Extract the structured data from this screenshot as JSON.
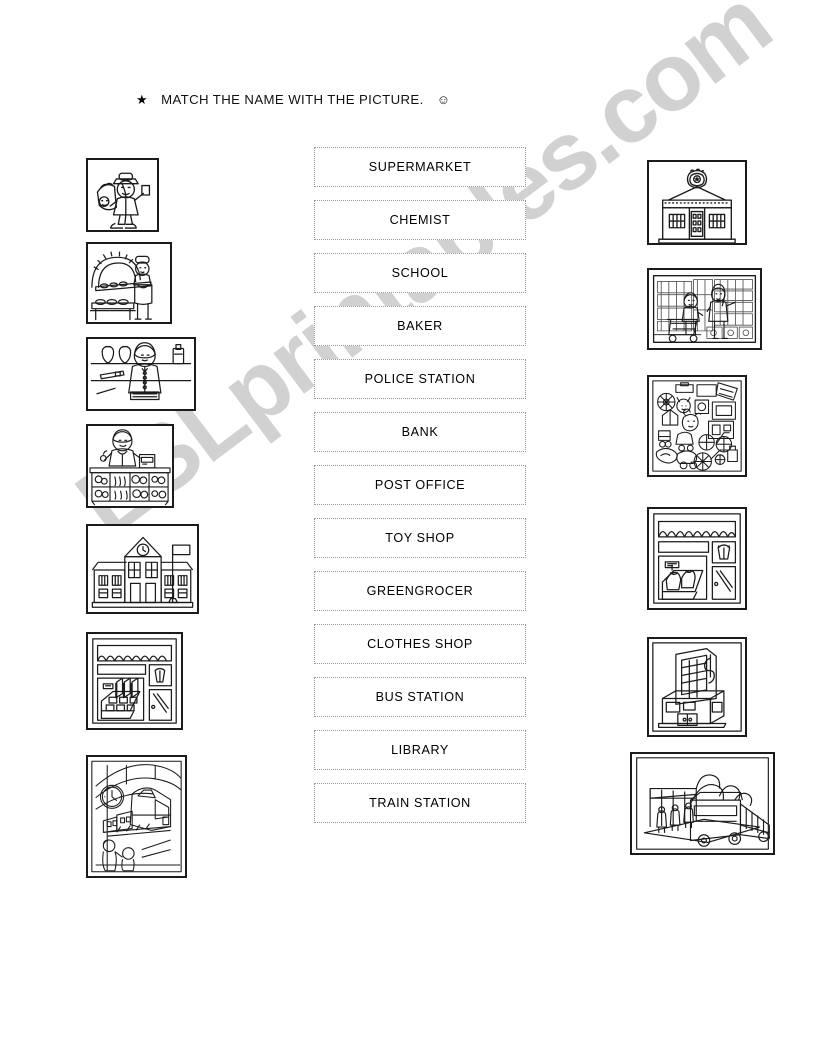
{
  "worksheet": {
    "instruction": {
      "bullet": "star-bullet",
      "text": "MATCH THE NAME WITH THE PICTURE.",
      "emoji": "smiley-face"
    },
    "watermark": "ESLprintables.com"
  },
  "word_boxes": [
    {
      "label": "SUPERMARKET"
    },
    {
      "label": "CHEMIST"
    },
    {
      "label": "SCHOOL"
    },
    {
      "label": "BAKER"
    },
    {
      "label": "POLICE STATION"
    },
    {
      "label": "BANK"
    },
    {
      "label": "POST OFFICE"
    },
    {
      "label": "TOY SHOP"
    },
    {
      "label": "GREENGROCER"
    },
    {
      "label": "CLOTHES SHOP"
    },
    {
      "label": "BUS STATION"
    },
    {
      "label": "LIBRARY"
    },
    {
      "label": "TRAIN STATION"
    }
  ],
  "left_pictures": [
    {
      "name": "postman-picture"
    },
    {
      "name": "baker-picture"
    },
    {
      "name": "chemist-picture"
    },
    {
      "name": "greengrocer-picture"
    },
    {
      "name": "school-picture"
    },
    {
      "name": "bookshop-picture"
    },
    {
      "name": "train-station-picture"
    }
  ],
  "right_pictures": [
    {
      "name": "police-station-picture"
    },
    {
      "name": "supermarket-picture"
    },
    {
      "name": "toy-shop-picture"
    },
    {
      "name": "clothes-shop-picture"
    },
    {
      "name": "bank-picture"
    },
    {
      "name": "bus-station-picture"
    }
  ]
}
